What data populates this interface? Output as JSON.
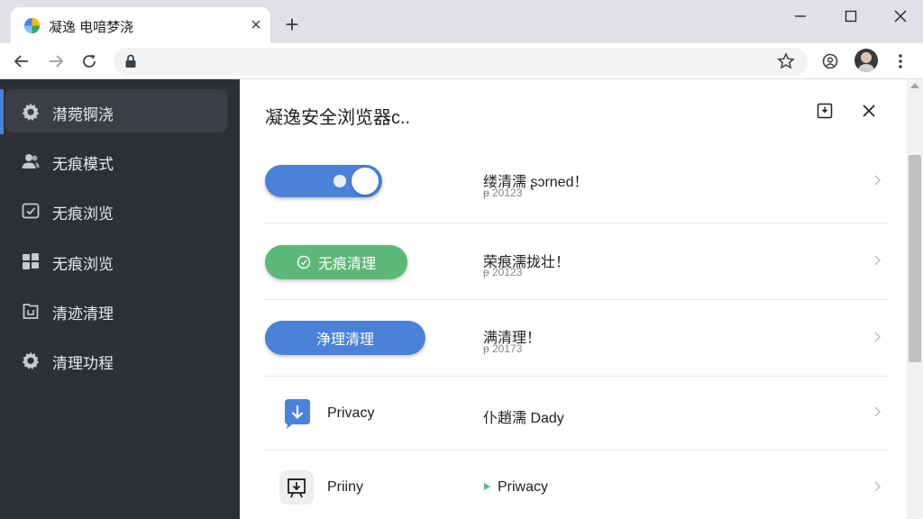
{
  "browser": {
    "tab_title": "凝逸 电喑梦浇",
    "favicon": "app-logo-icon",
    "address_value": "",
    "address_placeholder": ""
  },
  "sidebar": {
    "items": [
      {
        "label": "潸菀锕浇",
        "icon": "gear-icon",
        "active": true
      },
      {
        "label": "无痕模式",
        "icon": "users-icon",
        "active": false
      },
      {
        "label": "无痕浏览",
        "icon": "check-square-icon",
        "active": false
      },
      {
        "label": "无痕浏览",
        "icon": "grid-icon",
        "active": false
      },
      {
        "label": "清迹清理",
        "icon": "folder-icon",
        "active": false
      },
      {
        "label": "清理功程",
        "icon": "gear-icon",
        "active": false
      }
    ]
  },
  "panel": {
    "title": "凝逸安全浏览器c..",
    "rows": [
      {
        "control": "toggle",
        "toggle_on": true,
        "text": "缕清濡 ʂɔrned！",
        "sub": "ᵽ 20123"
      },
      {
        "control": "pill",
        "pill_label": "无痕清理",
        "pill_color": "#5bb876",
        "text": "荣痕濡拢壮！",
        "sub": "ᵽ 20123"
      },
      {
        "control": "pill",
        "pill_label": "浄理清理",
        "pill_color": "#4a82d9",
        "text": "满清理！",
        "sub": "ᵽ 20173"
      },
      {
        "control": "app",
        "app_label": "Privacy",
        "app_icon": "download-icon",
        "text": "仆趙濡 Dady",
        "sub": ""
      },
      {
        "control": "app",
        "app_label": "Priiny",
        "app_icon": "download-box-icon",
        "text": "Priwacy",
        "sub": ""
      }
    ]
  },
  "colors": {
    "accent_blue": "#4a82d9",
    "accent_green": "#5bb876",
    "sidebar_bg": "#2c2f33"
  }
}
